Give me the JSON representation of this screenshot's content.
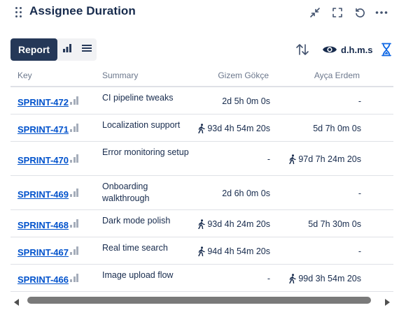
{
  "header": {
    "title": "Assignee Duration",
    "icons": [
      "drag-handle-icon",
      "collapse-icon",
      "expand-icon",
      "refresh-icon",
      "more-icon"
    ]
  },
  "toolbar": {
    "report_label": "Report",
    "chart_icon": "bar-chart-icon",
    "list_icon": "list-icon",
    "sort_icon": "sort-arrows-icon",
    "view_icon": "eye-icon",
    "format_label": "d.h.m.s",
    "timer_icon": "hourglass-icon"
  },
  "colors": {
    "accent": "#253858",
    "link": "#0052cc",
    "hourglass": "#0c66e4"
  },
  "table": {
    "columns": [
      "Key",
      "Summary",
      "Gizem Gökçe",
      "Ayça Erdem"
    ],
    "rows": [
      {
        "key": "SPRINT-472",
        "summary": "CI pipeline tweaks",
        "col1": "2d 5h 0m 0s",
        "col1_active": false,
        "col2": "-",
        "col2_active": false
      },
      {
        "key": "SPRINT-471",
        "summary": "Localization support",
        "col1": "93d 4h 54m 20s",
        "col1_active": true,
        "col2": "5d 7h 0m 0s",
        "col2_active": false
      },
      {
        "key": "SPRINT-470",
        "summary": "Error monitoring setup",
        "col1": "-",
        "col1_active": false,
        "col2": "97d 7h 24m 20s",
        "col2_active": true
      },
      {
        "key": "SPRINT-469",
        "summary": "Onboarding walkthrough",
        "col1": "2d 6h 0m 0s",
        "col1_active": false,
        "col2": "-",
        "col2_active": false
      },
      {
        "key": "SPRINT-468",
        "summary": "Dark mode polish",
        "col1": "93d 4h 24m 20s",
        "col1_active": true,
        "col2": "5d 7h 30m 0s",
        "col2_active": false
      },
      {
        "key": "SPRINT-467",
        "summary": "Real time search",
        "col1": "94d 4h 54m 20s",
        "col1_active": true,
        "col2": "-",
        "col2_active": false
      },
      {
        "key": "SPRINT-466",
        "summary": "Image upload flow",
        "col1": "-",
        "col1_active": false,
        "col2": "99d 3h 54m 20s",
        "col2_active": true
      }
    ]
  }
}
